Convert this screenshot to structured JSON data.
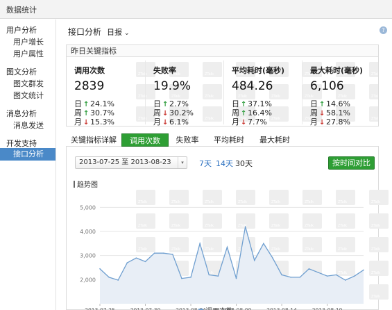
{
  "window": {
    "title": "数据统计"
  },
  "sidebar": {
    "groups": [
      {
        "label": "用户分析",
        "items": [
          "用户增长",
          "用户属性"
        ]
      },
      {
        "label": "图文分析",
        "items": [
          "图文群发",
          "图文统计"
        ]
      },
      {
        "label": "消息分析",
        "items": [
          "消息发送"
        ]
      },
      {
        "label": "开发支持",
        "items": [
          "接口分析"
        ]
      }
    ],
    "active_item": "接口分析"
  },
  "header": {
    "title": "接口分析",
    "period": "日报",
    "help_icon": "question-icon"
  },
  "key_metrics": {
    "title": "昨日关键指标",
    "metrics": [
      {
        "label": "调用次数",
        "value": "2839",
        "rows": [
          {
            "k": "日",
            "dir": "up",
            "v": "24.1%"
          },
          {
            "k": "周",
            "dir": "up",
            "v": "30.7%"
          },
          {
            "k": "月",
            "dir": "down",
            "v": "15.3%"
          }
        ]
      },
      {
        "label": "失败率",
        "value": "19.9%",
        "rows": [
          {
            "k": "日",
            "dir": "up",
            "v": "2.7%"
          },
          {
            "k": "周",
            "dir": "down",
            "v": "30.2%"
          },
          {
            "k": "月",
            "dir": "down",
            "v": "6.1%"
          }
        ]
      },
      {
        "label": "平均耗时(毫秒)",
        "value": "484.26",
        "rows": [
          {
            "k": "日",
            "dir": "up",
            "v": "37.1%"
          },
          {
            "k": "周",
            "dir": "up",
            "v": "16.4%"
          },
          {
            "k": "月",
            "dir": "down",
            "v": "7.7%"
          }
        ]
      },
      {
        "label": "最大耗时(毫秒)",
        "value": "6,106",
        "rows": [
          {
            "k": "日",
            "dir": "up",
            "v": "14.6%"
          },
          {
            "k": "周",
            "dir": "down",
            "v": "58.1%"
          },
          {
            "k": "月",
            "dir": "down",
            "v": "27.8%"
          }
        ]
      }
    ]
  },
  "tabs": {
    "items": [
      "关键指标详解",
      "调用次数",
      "失败率",
      "平均耗时",
      "最大耗时"
    ],
    "active": "调用次数"
  },
  "controls": {
    "date_range": "2013-07-25 至 2013-08-23",
    "quick_ranges": [
      "7天",
      "14天",
      "30天"
    ],
    "active_range": "30天",
    "compare_button": "按时间对比"
  },
  "trend": {
    "title": "趋势图"
  },
  "colors": {
    "accent_green": "#2e9e34",
    "nav_blue": "#4a89c8",
    "link_blue": "#2a6fc0",
    "up_green": "#2b9b3a",
    "down_red": "#c8322c",
    "series": "#6f9fd0"
  },
  "chart_data": {
    "type": "area",
    "title": "趋势图",
    "series": [
      {
        "name": "调用次数",
        "color": "#6f9fd0"
      }
    ],
    "x": [
      "2013-07-25",
      "2013-07-26",
      "2013-07-27",
      "2013-07-28",
      "2013-07-29",
      "2013-07-30",
      "2013-07-31",
      "2013-08-01",
      "2013-08-02",
      "2013-08-03",
      "2013-08-04",
      "2013-08-05",
      "2013-08-06",
      "2013-08-07",
      "2013-08-08",
      "2013-08-09",
      "2013-08-10",
      "2013-08-11",
      "2013-08-12",
      "2013-08-13",
      "2013-08-14",
      "2013-08-15",
      "2013-08-16",
      "2013-08-17",
      "2013-08-18",
      "2013-08-19",
      "2013-08-20",
      "2013-08-21",
      "2013-08-22",
      "2013-08-23"
    ],
    "y": [
      2450,
      2100,
      1980,
      2700,
      2900,
      2750,
      3100,
      3100,
      3050,
      2050,
      2100,
      3500,
      2200,
      2150,
      3350,
      2050,
      4200,
      2800,
      3500,
      2900,
      2200,
      2100,
      2100,
      2450,
      2300,
      2150,
      2200,
      1980,
      2150,
      2400
    ],
    "xticks": [
      "2013-07-25",
      "2013-07-30",
      "2013-08-04",
      "2013-08-09",
      "2013-08-14",
      "2013-08-19"
    ],
    "yticks": [
      "2,000",
      "3,000",
      "4,000",
      "5,000"
    ],
    "ylim": [
      1000,
      5500
    ],
    "grid": true,
    "legend_position": "bottom"
  }
}
